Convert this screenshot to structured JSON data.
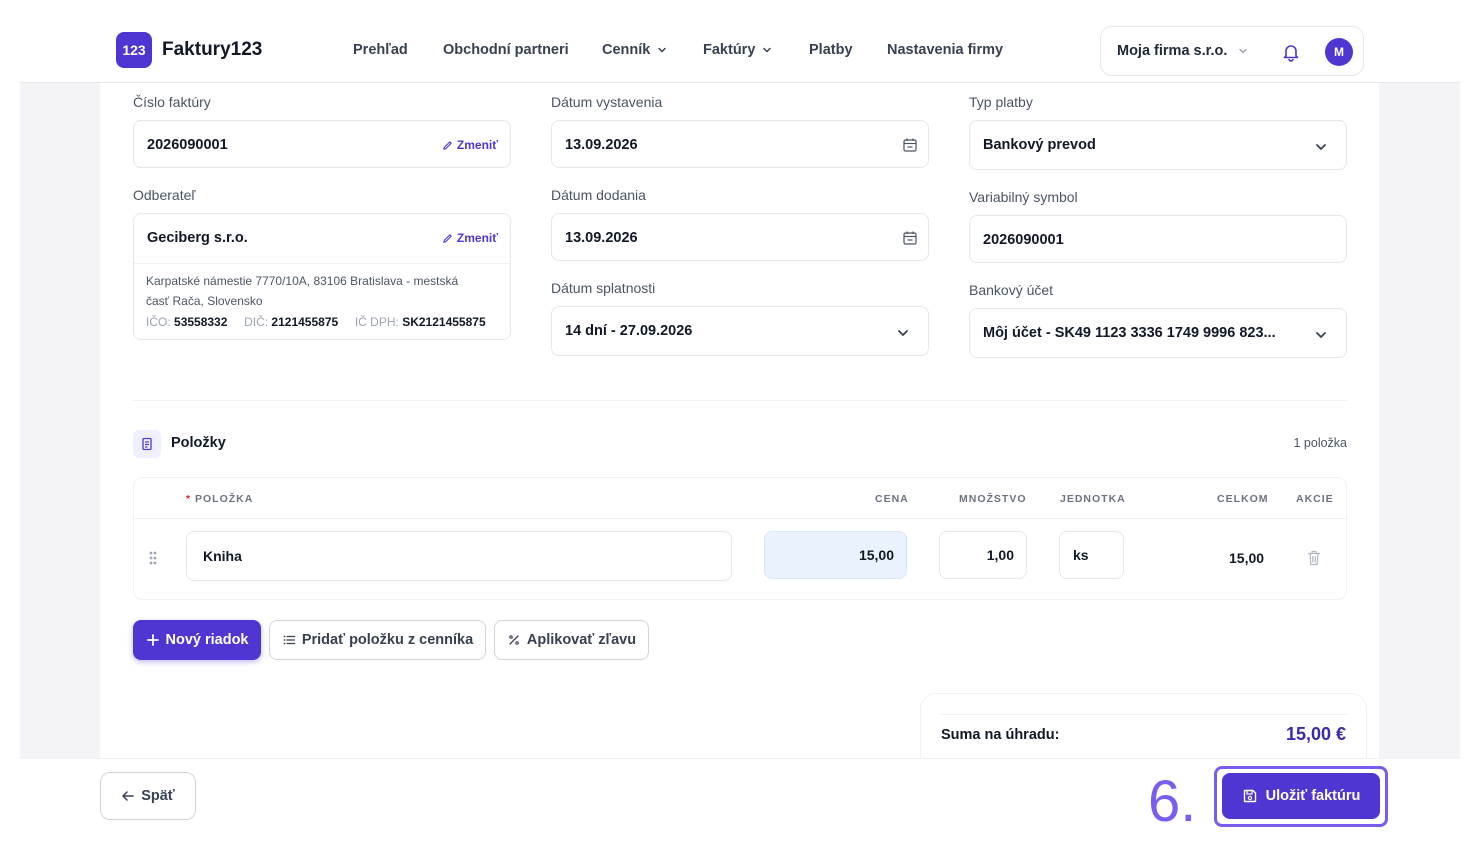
{
  "app": {
    "logo_badge": "123",
    "name": "Faktury123"
  },
  "nav": {
    "items": [
      {
        "label": "Prehľad"
      },
      {
        "label": "Obchodní partneri"
      },
      {
        "label": "Cenník"
      },
      {
        "label": "Faktúry"
      },
      {
        "label": "Platby"
      },
      {
        "label": "Nastavenia firmy"
      }
    ],
    "company": "Moja firma s.r.o.",
    "avatar": "M"
  },
  "form": {
    "invoice_number": {
      "label": "Číslo faktúry",
      "value": "2026090001",
      "change": "Zmeniť"
    },
    "issue_date": {
      "label": "Dátum vystavenia",
      "value": "13.09.2026"
    },
    "payment_type": {
      "label": "Typ platby",
      "value": "Bankový prevod"
    },
    "customer": {
      "label": "Odberateľ",
      "name": "Geciberg s.r.o.",
      "change": "Zmeniť",
      "address_line1": "Karpatské námestie 7770/10A, 83106 Bratislava - mestská",
      "address_line2": "časť Rača, Slovensko",
      "ico_label": "IČO:",
      "ico": "53558332",
      "dic_label": "DIČ:",
      "dic": "2121455875",
      "icdph_label": "IČ DPH:",
      "icdph": "SK2121455875"
    },
    "delivery_date": {
      "label": "Dátum dodania",
      "value": "13.09.2026"
    },
    "variable_symbol": {
      "label": "Variabilný symbol",
      "value": "2026090001"
    },
    "due_date": {
      "label": "Dátum splatnosti",
      "value": "14 dní - 27.09.2026"
    },
    "bank_account": {
      "label": "Bankový účet",
      "value": "Môj účet - SK49 1123 3336 1749 9996 823..."
    }
  },
  "items": {
    "title": "Položky",
    "count": "1 položka",
    "headers": {
      "required_mark": "*",
      "item": "POLOŽKA",
      "price": "CENA",
      "quantity": "MNOŽSTVO",
      "unit": "JEDNOTKA",
      "total": "CELKOM",
      "actions": "AKCIE"
    },
    "rows": [
      {
        "name": "Kniha",
        "price": "15,00",
        "quantity": "1,00",
        "unit": "ks",
        "total": "15,00"
      }
    ]
  },
  "actions": {
    "new_row": "Nový riadok",
    "add_from_pricelist": "Pridať položku z cenníka",
    "apply_discount": "Aplikovať zľavu"
  },
  "summary": {
    "label": "Suma na úhradu:",
    "value": "15,00 €"
  },
  "footer": {
    "back": "Späť",
    "save": "Uložiť faktúru",
    "step_number": "6."
  },
  "colors": {
    "primary": "#4f35d2",
    "highlight": "#7b5cf0",
    "price_bg": "#eaf2fe"
  },
  "icons": [
    "calendar-icon",
    "chevron-down-icon",
    "pencil-icon",
    "bell-icon",
    "receipt-icon",
    "drag-handle-icon",
    "trash-icon",
    "plus-icon",
    "list-icon",
    "percent-icon",
    "arrow-left-icon",
    "save-icon"
  ]
}
